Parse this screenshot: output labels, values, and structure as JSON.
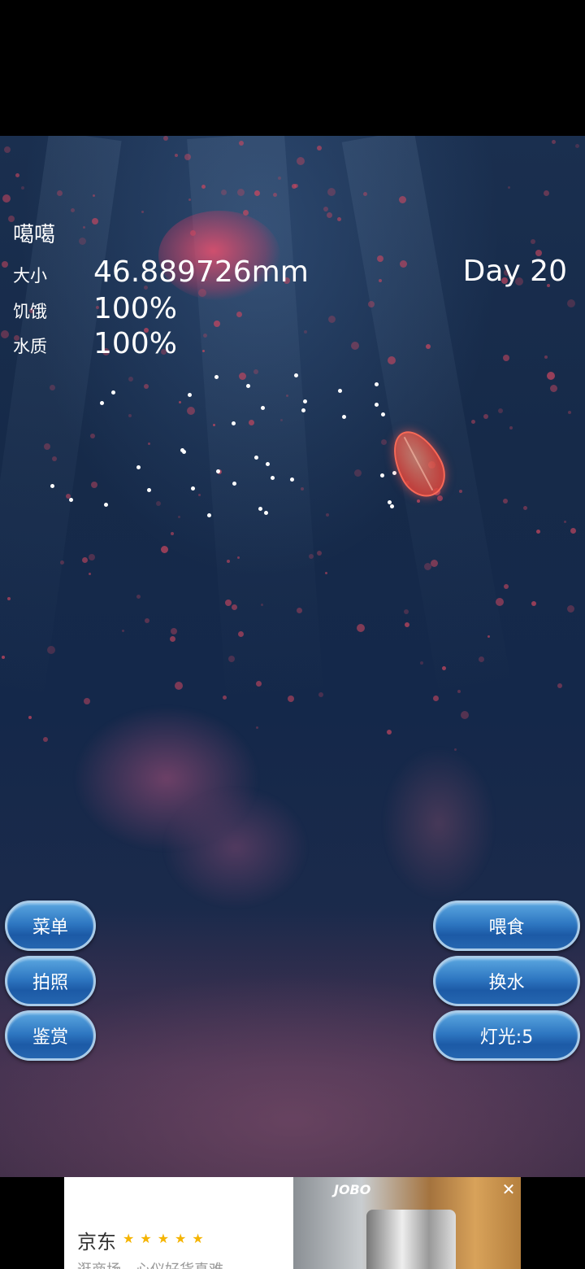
{
  "stats": {
    "name": "噶噶",
    "size_label": "大小",
    "size_value": "46.889726mm",
    "hunger_label": "饥饿",
    "hunger_value": "100%",
    "water_label": "水质",
    "water_value": "100%",
    "day": "Day 20"
  },
  "buttons": {
    "menu": "菜单",
    "photo": "拍照",
    "appreciate": "鉴赏",
    "feed": "喂食",
    "change_water": "换水",
    "light": "灯光:5"
  },
  "ad": {
    "title": "京东",
    "stars": "★★★★★",
    "subtitle": "逛商场，心仪好货真难…",
    "brand": "JOBO",
    "close": "✕"
  },
  "colors": {
    "button": "#2f78c2",
    "water": "#162a49",
    "particle": "#c8475f"
  }
}
